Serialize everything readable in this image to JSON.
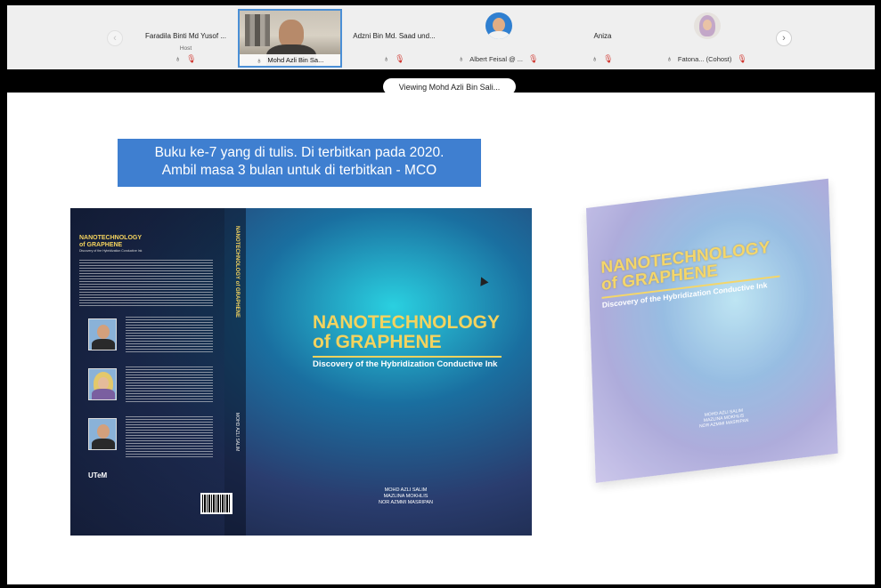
{
  "participants_strip": {
    "prev_icon": "chevron-left-icon",
    "next_icon": "chevron-right-icon",
    "tiles": [
      {
        "name": "Faradila Binti Md Yusof ...",
        "role": "Host",
        "audio_icon": "mic-icon",
        "mute_icon": "mic-muted-icon"
      },
      {
        "name": "Mohd Azli Bin Sa...",
        "audio_icon": "speaking-audio-icon",
        "active_speaker": true
      },
      {
        "name": "Adzni Bin Md. Saad und...",
        "audio_icon": "mic-icon",
        "mute_icon": "mic-muted-icon"
      },
      {
        "name": "Albert Feisal @ ...",
        "audio_icon": "mic-icon",
        "mute_icon": "mic-muted-icon"
      },
      {
        "name": "Aniza",
        "audio_icon": "mic-icon",
        "mute_icon": "mic-muted-icon"
      },
      {
        "name": "Fatona... (Cohost)",
        "audio_icon": "mic-icon",
        "mute_icon": "mic-muted-icon"
      }
    ]
  },
  "share_banner": {
    "text": "Viewing Mohd Azli Bin Sali..."
  },
  "slide": {
    "caption_line1": "Buku ke-7 yang di tulis. Di terbitkan pada 2020.",
    "caption_line2": "Ambil masa 3 bulan untuk di terbitkan - MCO",
    "caption_color": "#3f7fd0",
    "book": {
      "title_line1": "NANOTECHNOLOGY",
      "title_line2": "of GRAPHENE",
      "subtitle": "Discovery of the Hybridization Conductive Ink",
      "authors": [
        "MOHD AZLI SALIM",
        "MAZLINA MOKHLIS",
        "NOR AZMMI MASRIPAN"
      ],
      "publisher_logo": "UTeM",
      "title_color": "#f4d35e"
    }
  }
}
